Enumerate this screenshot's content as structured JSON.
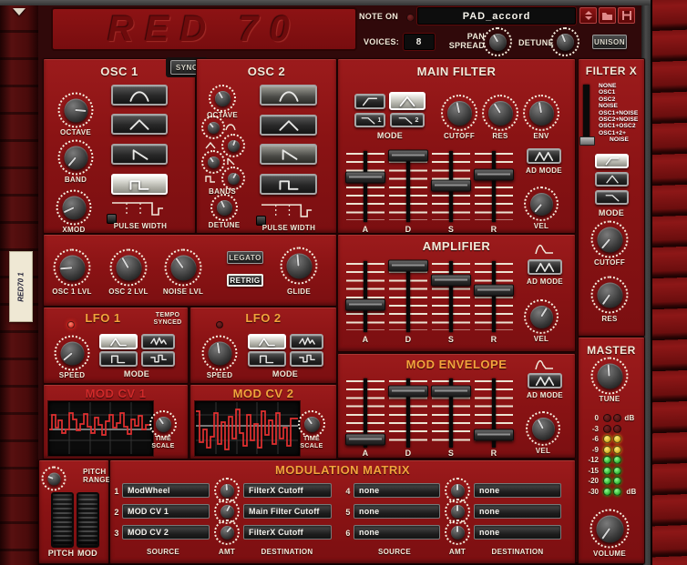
{
  "window": {
    "logo": "RED 70",
    "tape_label": "RED70 1"
  },
  "header": {
    "note_on_label": "NOTE ON",
    "preset_name": "PAD_accord",
    "voices_label": "VOICES:",
    "voices_value": "8",
    "pan_spread_label": "PAN SPREAD",
    "detune_label": "DETUNE",
    "unison_label": "UNISON"
  },
  "osc1": {
    "title": "OSC 1",
    "sync_label": "SYNC",
    "octave_label": "OCTAVE",
    "band_label": "BAND",
    "xmod_label": "XMOD",
    "pulse_width_label": "PULSE WIDTH",
    "selected_waveform": "square"
  },
  "osc2": {
    "title": "OSC 2",
    "octave_label": "OCTAVE",
    "bands_label": "BANDS",
    "detune_label": "DETUNE",
    "pulse_width_label": "PULSE WIDTH"
  },
  "main_filter": {
    "title": "MAIN FILTER",
    "mode_label": "MODE",
    "selected_mode": "bandpass",
    "mode_tags": [
      "1",
      "2"
    ],
    "cutoff_label": "CUTOFF",
    "res_label": "RES",
    "env_label": "ENV",
    "ad_mode_label": "AD MODE",
    "vel_label": "VEL",
    "slider_labels": [
      "A",
      "D",
      "S",
      "R"
    ]
  },
  "filter_x": {
    "title": "FILTER X",
    "routing_options": [
      "NONE",
      "OSC1",
      "OSC2",
      "NOISE",
      "OSC1+NOISE",
      "OSC2+NOISE",
      "OSC1+OSC2",
      "OSC1+2+",
      "NOISE"
    ],
    "selected_routing": "OSC1+2+NOISE",
    "mode_label": "MODE",
    "selected_mode": "highpass",
    "cutoff_label": "CUTOFF",
    "res_label": "RES"
  },
  "amplifier": {
    "title": "AMPLIFIER",
    "ad_mode_label": "AD MODE",
    "vel_label": "VEL",
    "slider_labels": [
      "A",
      "D",
      "S",
      "R"
    ]
  },
  "mod_envelope": {
    "title": "MOD ENVELOPE",
    "ad_mode_label": "AD MODE",
    "vel_label": "VEL",
    "slider_labels": [
      "A",
      "D",
      "S",
      "R"
    ]
  },
  "mixer": {
    "osc1_lvl_label": "OSC 1 LVL",
    "osc2_lvl_label": "OSC 2 LVL",
    "noise_lvl_label": "NOISE LVL",
    "legato_label": "LEGATO",
    "retrig_label": "RETRIG",
    "glide_label": "GLIDE"
  },
  "lfo1": {
    "title": "LFO 1",
    "tempo_synced_label": "TEMPO SYNCED",
    "speed_label": "SPEED",
    "mode_label": "MODE"
  },
  "lfo2": {
    "title": "LFO 2",
    "speed_label": "SPEED",
    "mode_label": "MODE"
  },
  "mod_cv1": {
    "title": "MOD CV 1",
    "time_scale_label": "TIME SCALE"
  },
  "mod_cv2": {
    "title": "MOD CV 2",
    "time_scale_label": "TIME SCALE"
  },
  "master": {
    "title": "MASTER",
    "tune_label": "TUNE",
    "volume_label": "VOLUME",
    "db_label": "dB",
    "meter_labels": [
      "0",
      "-3",
      "-6",
      "-9",
      "-12",
      "-15",
      "-20",
      "-30"
    ],
    "meter_colors": {
      "unlit_red": "#5c1212",
      "yellow": "#d8b000",
      "green": "#18b418"
    }
  },
  "pitch_section": {
    "range_label": "PITCH RANGE",
    "pitch_label": "PITCH",
    "mod_label": "MOD"
  },
  "matrix": {
    "title": "MODULATION MATRIX",
    "source_label": "SOURCE",
    "amt_label": "AMT",
    "destination_label": "DESTINATION",
    "rows": [
      {
        "num": "1",
        "source": "ModWheel",
        "destination": "FilterX Cutoff"
      },
      {
        "num": "2",
        "source": "MOD CV 1",
        "destination": "Main Filter Cutoff"
      },
      {
        "num": "3",
        "source": "MOD CV 2",
        "destination": "FilterX Cutoff"
      },
      {
        "num": "4",
        "source": "none",
        "destination": "none"
      },
      {
        "num": "5",
        "source": "none",
        "destination": "none"
      },
      {
        "num": "6",
        "source": "none",
        "destination": "none"
      }
    ]
  },
  "colors": {
    "panel_red": "#8a1314",
    "title_orange": "#f2a43c",
    "title_red": "#d02a2a",
    "lcd_wave_red": "#e23030"
  }
}
